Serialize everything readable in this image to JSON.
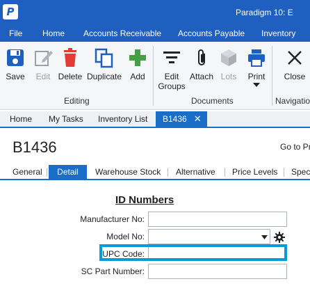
{
  "app": {
    "logo_letter": "P",
    "title": "Paradigm 10: E"
  },
  "menu": [
    "File",
    "Home",
    "Accounts Receivable",
    "Accounts Payable",
    "Inventory"
  ],
  "ribbon": {
    "editing": {
      "label": "Editing",
      "save": "Save",
      "edit": "Edit",
      "delete": "Delete",
      "duplicate": "Duplicate",
      "add": "Add"
    },
    "documents": {
      "label": "Documents",
      "edit_groups_1": "Edit",
      "edit_groups_2": "Groups",
      "attach": "Attach",
      "lots": "Lots",
      "print": "Print"
    },
    "navigation": {
      "label": "Navigation",
      "close": "Close"
    }
  },
  "doc_tabs": [
    "Home",
    "My Tasks",
    "Inventory List",
    "B1436"
  ],
  "doc_tab_close": "✕",
  "record": {
    "title": "B1436",
    "goto": "Go to Pr"
  },
  "sub_tabs": [
    "General",
    "Detail",
    "Warehouse Stock",
    "Alternative",
    "Price Levels",
    "Spec"
  ],
  "form": {
    "section_title": "ID Numbers",
    "manufacturer_label": "Manufacturer No:",
    "manufacturer_value": "",
    "model_label": "Model No:",
    "model_value": "",
    "upc_label": "UPC Code:",
    "upc_value": "",
    "sc_part_label": "SC Part Number:",
    "sc_part_value": ""
  },
  "icons": {
    "save": "save-icon",
    "edit": "edit-icon",
    "delete": "delete-icon",
    "duplicate": "duplicate-icon",
    "add": "add-icon",
    "edit_groups": "edit-groups-icon",
    "attach": "attach-icon",
    "lots": "lots-icon",
    "print": "print-icon",
    "close": "close-icon",
    "settings": "gear-icon"
  },
  "colors": {
    "brand_blue": "#1f5fbf",
    "tab_active": "#1a6ec8",
    "highlight": "#0a9bd6",
    "delete_red": "#e53935",
    "add_green": "#43a047"
  }
}
